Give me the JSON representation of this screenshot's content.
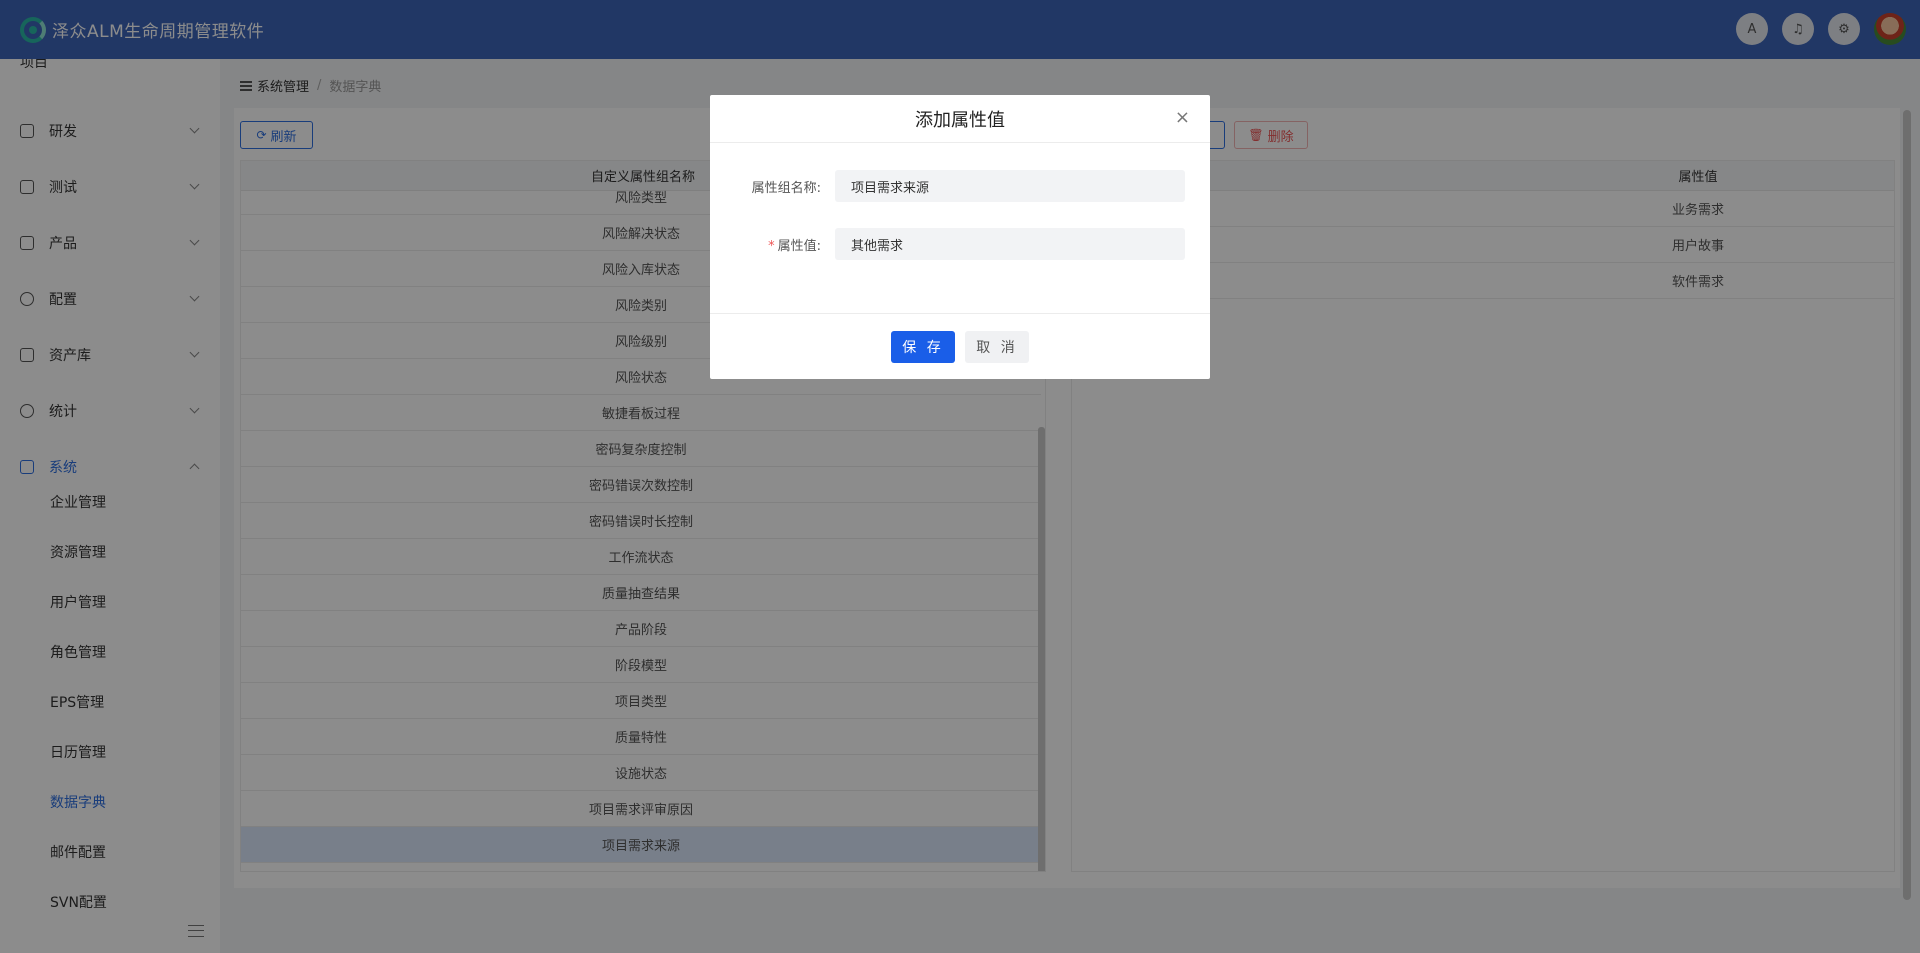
{
  "app": {
    "title": "泽众ALM生命周期管理软件"
  },
  "header_tools": [
    "translate-icon",
    "bell-icon",
    "gear-icon",
    "avatar"
  ],
  "sidebar": {
    "cutoff_label": "项目",
    "groups": [
      {
        "label": "研发",
        "icon": "layers-icon"
      },
      {
        "label": "测试",
        "icon": "clipboard-icon"
      },
      {
        "label": "产品",
        "icon": "layers-icon"
      },
      {
        "label": "配置",
        "icon": "gear-icon"
      },
      {
        "label": "资产库",
        "icon": "shield-icon"
      },
      {
        "label": "统计",
        "icon": "pie-icon"
      },
      {
        "label": "系统",
        "icon": "system-icon"
      }
    ],
    "sub_items": [
      "企业管理",
      "资源管理",
      "用户管理",
      "角色管理",
      "EPS管理",
      "日历管理",
      "数据字典",
      "邮件配置",
      "SVN配置"
    ],
    "active_sub": "数据字典"
  },
  "breadcrumb": {
    "first": "系统管理",
    "separator": "/",
    "current": "数据字典"
  },
  "toolbar": {
    "refresh_label": "刷新",
    "delete_label": "删除"
  },
  "left_table": {
    "header": "自定义属性组名称",
    "rows": [
      "风险类型",
      "风险解决状态",
      "风险入库状态",
      "风险类别",
      "风险级别",
      "风险状态",
      "敏捷看板过程",
      "密码复杂度控制",
      "密码错误次数控制",
      "密码错误时长控制",
      "工作流状态",
      "质量抽查结果",
      "产品阶段",
      "阶段模型",
      "项目类型",
      "质量特性",
      "设施状态",
      "项目需求评审原因",
      "项目需求来源"
    ],
    "selected": "项目需求来源"
  },
  "right_table": {
    "header": "属性值",
    "rows": [
      "业务需求",
      "用户故事",
      "软件需求"
    ]
  },
  "modal": {
    "title": "添加属性值",
    "group_name_label": "属性组名称:",
    "group_name_value": "项目需求来源",
    "value_label": "属性值:",
    "value_required_mark": "*",
    "value_value": "其他需求",
    "save_label": "保 存",
    "cancel_label": "取 消",
    "close_glyph": "×"
  },
  "colors": {
    "header": "#3c64b9",
    "accent": "#1a5ee8",
    "active": "#2e6fe0",
    "danger": "#e55555"
  }
}
